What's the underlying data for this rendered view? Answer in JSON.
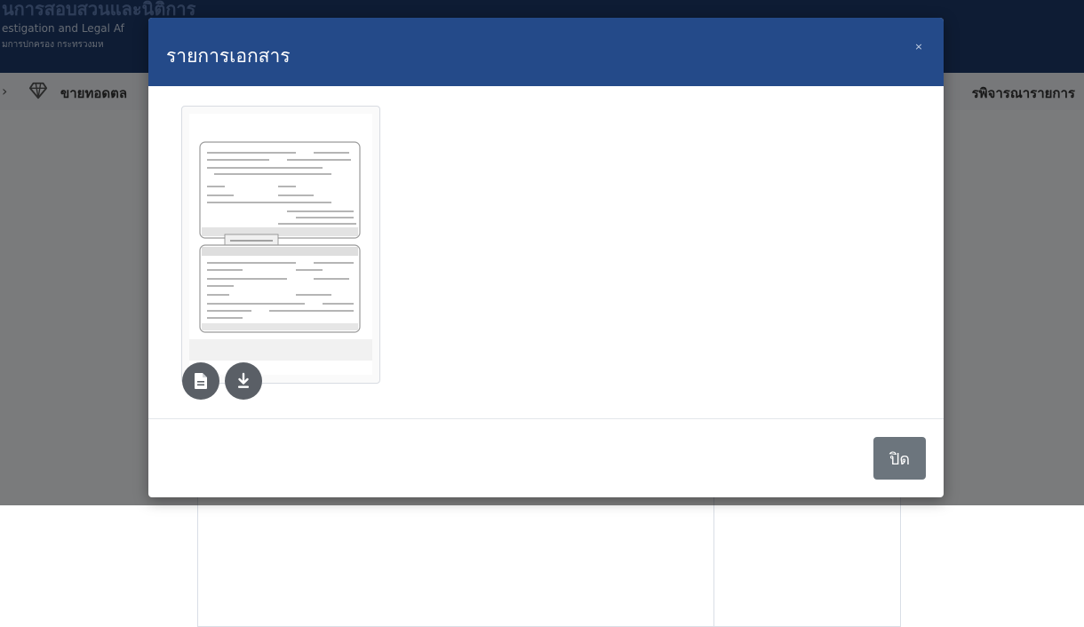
{
  "background": {
    "header": {
      "title_fragment": "นการสอบสวนและนิติการ",
      "subtitle_en": "estigation and Legal Af",
      "subtitle_th": "มการปกครอง กระทรวงมห"
    },
    "nav": {
      "left_label": "ขายทอดตล",
      "right_label": "รพิจารณารายการ"
    }
  },
  "modal": {
    "title": "รายการเอกสาร",
    "close_symbol": "×",
    "documents": [
      {
        "type": "scanned-document"
      }
    ],
    "footer": {
      "close_label": "ปิด"
    }
  },
  "colors": {
    "header_bg": "#1d3968",
    "modal_header_bg": "#244a89",
    "action_button": "#5a5f66",
    "footer_button": "#6c757d"
  }
}
